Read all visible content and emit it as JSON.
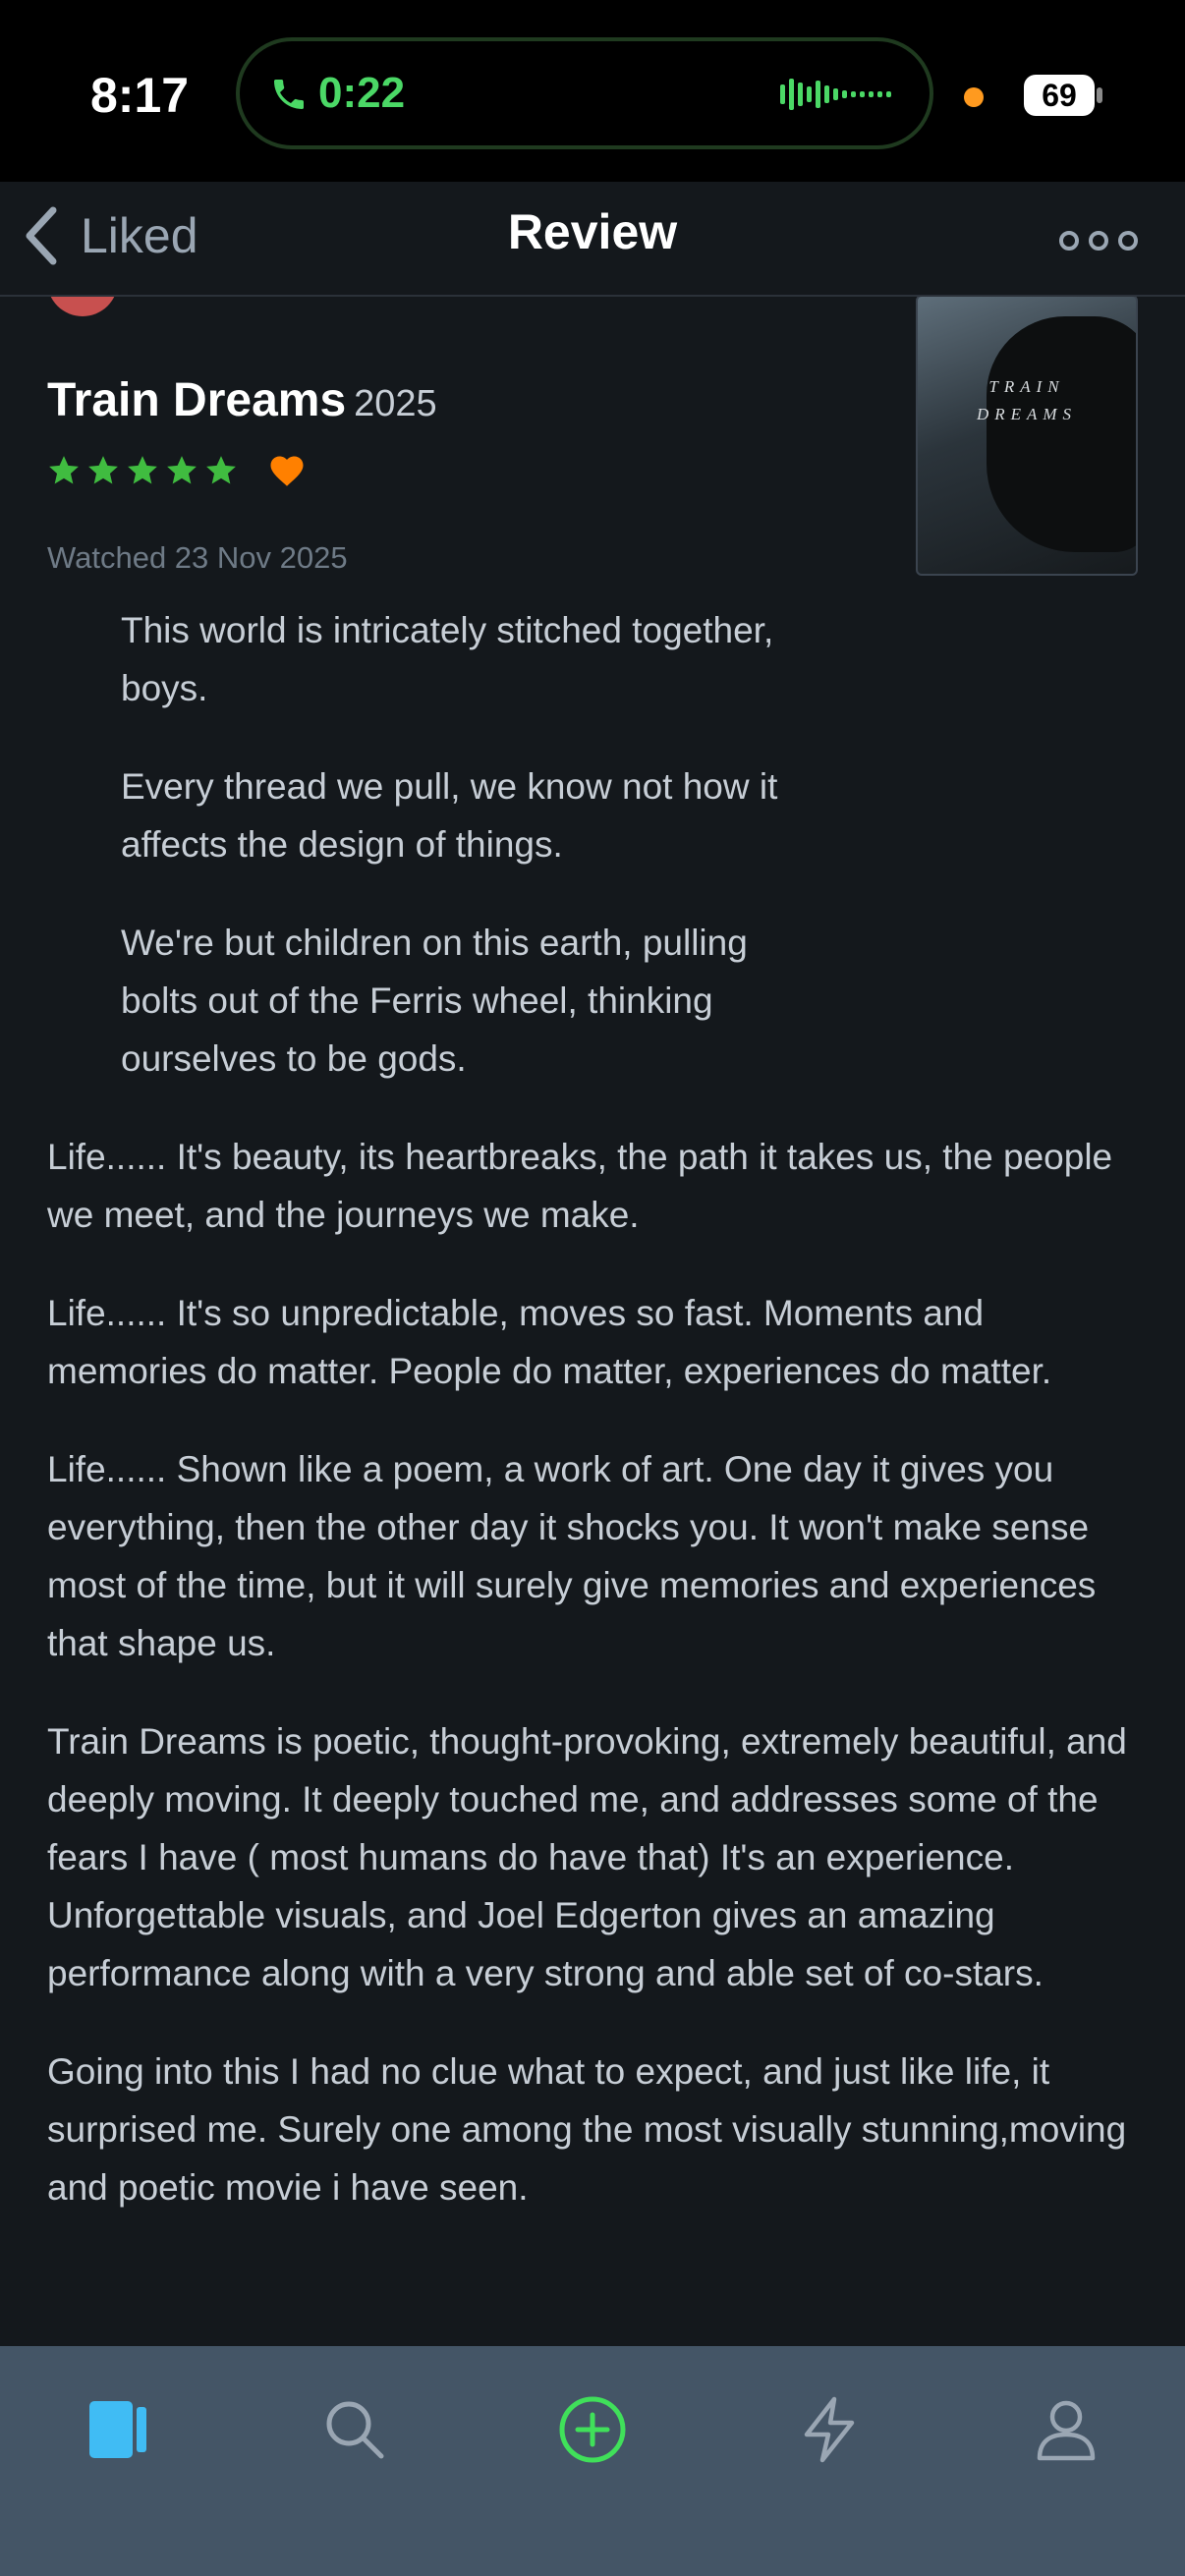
{
  "status_bar": {
    "time": "8:17",
    "call_duration": "0:22",
    "battery": "69"
  },
  "nav": {
    "back_label": "Liked",
    "title": "Review"
  },
  "film": {
    "title": "Train Dreams",
    "year": "2025",
    "stars": 5,
    "liked": true,
    "watched": "Watched 23 Nov 2025",
    "poster_text": [
      "TRAIN",
      "DREAMS"
    ]
  },
  "review": {
    "quotes": [
      "This world is intricately stitched together, boys.",
      "Every thread we pull, we know not how it affects the design of things.",
      "We're but children on this earth, pulling bolts out of the Ferris wheel, thinking ourselves to be gods."
    ],
    "paragraphs": [
      "Life...... It's beauty, its heartbreaks, the path it takes us, the people we meet, and the journeys we make.",
      "Life...... It's so unpredictable, moves so fast. Moments and memories do matter. People do matter, experiences do matter.",
      "Life...... Shown like a poem, a work of art. One day it gives you everything, then the other day it shocks you. It won't make sense most of the time, but it will surely give memories and experiences that shape us.",
      "Train Dreams is poetic, thought-provoking, extremely beautiful, and deeply moving. It deeply touched me, and addresses some of the fears I have ( most humans do have that) It's an experience. Unforgettable visuals, and Joel Edgerton gives an amazing performance along with a very strong and able set of co-stars.",
      "Going into this I had no clue what to expect, and just like life, it surprised me. Surely one among the most visually stunning,moving and poetic movie i have seen."
    ]
  },
  "tab_bar": {
    "tabs": [
      "films-icon",
      "search-icon",
      "add-log-icon",
      "activity-icon",
      "profile-icon"
    ],
    "active": "films-icon"
  },
  "colors": {
    "background": "#14181c",
    "star_green": "#40bc40",
    "heart_orange": "#ff8000",
    "tab_bar": "#445566",
    "accent_blue": "#40bcf4",
    "call_green": "#4bd866"
  }
}
